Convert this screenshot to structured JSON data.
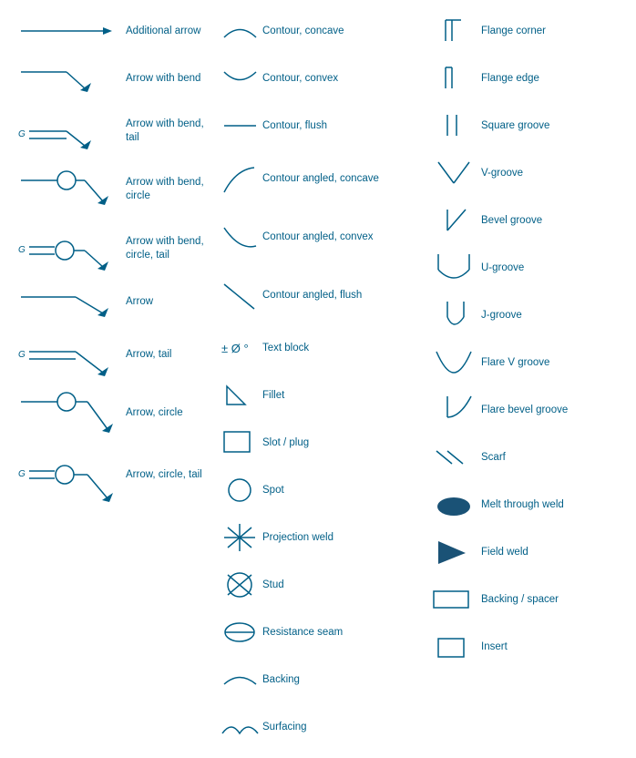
{
  "col1": {
    "items": [
      {
        "id": "additional-arrow",
        "label": "Additional arrow"
      },
      {
        "id": "arrow-with-bend",
        "label": "Arrow with bend"
      },
      {
        "id": "arrow-with-bend-tail",
        "label": "Arrow with bend,\ntail"
      },
      {
        "id": "arrow-with-bend-circle",
        "label": "Arrow with bend,\ncircle"
      },
      {
        "id": "arrow-with-bend-circle-tail",
        "label": "Arrow with bend,\ncircle, tail"
      },
      {
        "id": "arrow",
        "label": "Arrow"
      },
      {
        "id": "arrow-tail",
        "label": "Arrow, tail"
      },
      {
        "id": "arrow-circle",
        "label": "Arrow, circle"
      },
      {
        "id": "arrow-circle-tail",
        "label": "Arrow, circle, tail"
      }
    ]
  },
  "col2": {
    "items": [
      {
        "id": "contour-concave",
        "label": "Contour, concave"
      },
      {
        "id": "contour-convex",
        "label": "Contour, convex"
      },
      {
        "id": "contour-flush",
        "label": "Contour, flush"
      },
      {
        "id": "contour-angled-concave",
        "label": "Contour angled,\nconcave"
      },
      {
        "id": "contour-angled-convex",
        "label": "Contour angled,\nconvex"
      },
      {
        "id": "contour-angled-flush",
        "label": "Contour angled,\nflush"
      },
      {
        "id": "text-block",
        "label": "Text block"
      },
      {
        "id": "fillet",
        "label": "Fillet"
      },
      {
        "id": "slot-plug",
        "label": "Slot / plug"
      },
      {
        "id": "spot",
        "label": "Spot"
      },
      {
        "id": "projection-weld",
        "label": "Projection weld"
      },
      {
        "id": "stud",
        "label": "Stud"
      },
      {
        "id": "resistance-seam",
        "label": "Resistance seam"
      },
      {
        "id": "backing",
        "label": "Backing"
      },
      {
        "id": "surfacing",
        "label": "Surfacing"
      }
    ]
  },
  "col3": {
    "items": [
      {
        "id": "flange-corner",
        "label": "Flange corner"
      },
      {
        "id": "flange-edge",
        "label": "Flange edge"
      },
      {
        "id": "square-groove",
        "label": "Square groove"
      },
      {
        "id": "v-groove",
        "label": "V-groove"
      },
      {
        "id": "bevel-groove",
        "label": "Bevel groove"
      },
      {
        "id": "u-groove",
        "label": "U-groove"
      },
      {
        "id": "j-groove",
        "label": "J-groove"
      },
      {
        "id": "flare-v-groove",
        "label": "Flare V groove"
      },
      {
        "id": "flare-bevel-groove",
        "label": "Flare bevel groove"
      },
      {
        "id": "scarf",
        "label": "Scarf"
      },
      {
        "id": "melt-through-weld",
        "label": "Melt through weld"
      },
      {
        "id": "field-weld",
        "label": "Field weld"
      },
      {
        "id": "backing-spacer",
        "label": "Backing / spacer"
      },
      {
        "id": "insert",
        "label": "Insert"
      }
    ]
  }
}
